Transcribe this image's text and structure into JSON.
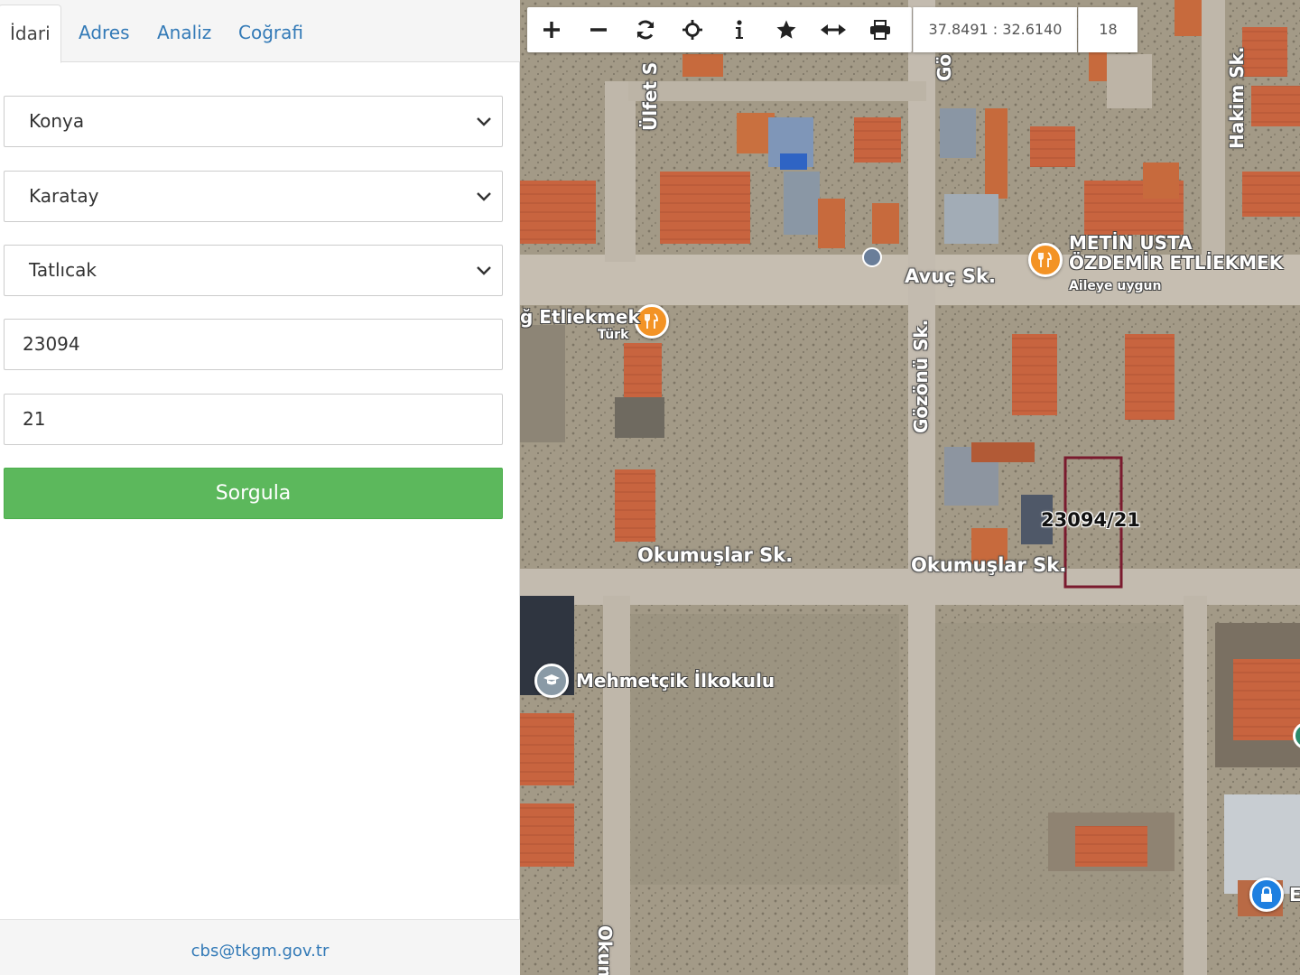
{
  "tabs": [
    {
      "label": "İdari",
      "active": true
    },
    {
      "label": "Adres",
      "active": false
    },
    {
      "label": "Analiz",
      "active": false
    },
    {
      "label": "Coğrafi",
      "active": false
    }
  ],
  "form": {
    "province": "Konya",
    "district": "Karatay",
    "neighborhood": "Tatlıcak",
    "block": "23094",
    "parcel": "21",
    "query_button": "Sorgula"
  },
  "footer": {
    "email": "cbs@tkgm.gov.tr"
  },
  "toolbar": {
    "tools": [
      "zoom-in-icon",
      "zoom-out-icon",
      "refresh-icon",
      "locate-icon",
      "info-icon",
      "favorite-icon",
      "measure-icon",
      "print-icon"
    ],
    "coordinates": "37.8491 : 32.6140",
    "zoom_level": "18"
  },
  "map": {
    "streets": {
      "ulfet": "Ülfet S",
      "gozonu_top": "Gö",
      "hakim": "Hakim Sk.",
      "avuc": "Avuç Sk.",
      "gozonu": "Gözönü Sk.",
      "okumuslar_1": "Okumuşlar Sk.",
      "okumuslar_2": "Okumuşlar Sk.",
      "okum_bottom": "Okum"
    },
    "pois": {
      "restaurant_1_name_line1": "METİN USTA",
      "restaurant_1_name_line2": "ÖZDEMİR ETLİEKMEK",
      "restaurant_1_sub": "Aileye uygun",
      "restaurant_2_name": "ğ Etliekmek",
      "restaurant_2_sub": "Türk",
      "school": "Mehmetçik İlkokulu",
      "partial_right": "E"
    },
    "parcel_label": "23094/21",
    "colors": {
      "parcel_outline": "#7a1a2e",
      "poi_restaurant": "#f39325",
      "poi_school": "#8a9aa6",
      "poi_lock": "#1e7fe0",
      "query_button": "#5cb85c"
    }
  }
}
